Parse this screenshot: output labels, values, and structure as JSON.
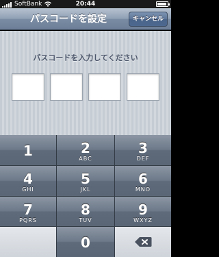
{
  "status_bar": {
    "carrier": "SoftBank",
    "time": "20:44",
    "icons": [
      "signal-icon",
      "wifi-icon",
      "battery-icon"
    ]
  },
  "nav": {
    "title": "パスコードを設定",
    "cancel_label": "キャンセル"
  },
  "passcode": {
    "prompt": "パスコードを入力してください",
    "digits_count": 4
  },
  "keypad": {
    "keys": [
      {
        "num": "1",
        "letters": ""
      },
      {
        "num": "2",
        "letters": "ABC"
      },
      {
        "num": "3",
        "letters": "DEF"
      },
      {
        "num": "4",
        "letters": "GHI"
      },
      {
        "num": "5",
        "letters": "JKL"
      },
      {
        "num": "6",
        "letters": "MNO"
      },
      {
        "num": "7",
        "letters": "PQRS"
      },
      {
        "num": "8",
        "letters": "TUV"
      },
      {
        "num": "9",
        "letters": "WXYZ"
      },
      {
        "num": "0",
        "letters": ""
      }
    ],
    "delete_icon": "backspace-icon"
  },
  "colors": {
    "nav_gradient_top": "#b7c2d0",
    "nav_gradient_bottom": "#6d7f98",
    "cancel_button": "#5c7598",
    "passcode_background": "#cbd2d8",
    "prompt_text": "#4c566a",
    "key_top": "#8c96a4",
    "key_bottom": "#5a6676",
    "special_key": "#dadee3"
  }
}
